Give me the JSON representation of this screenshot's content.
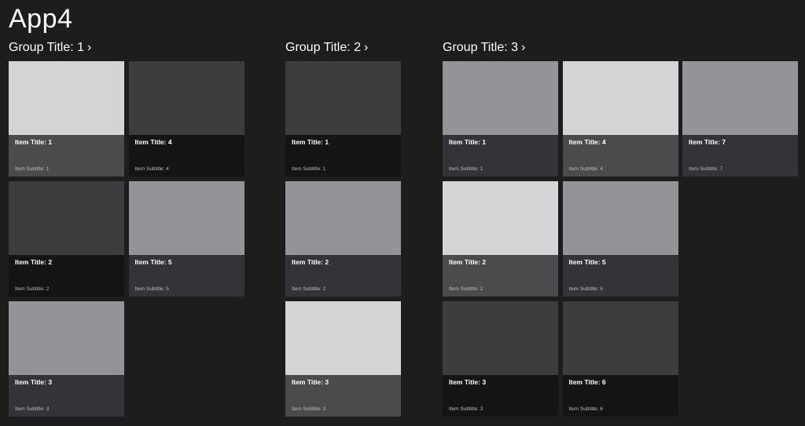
{
  "app": {
    "title": "App4"
  },
  "groups": [
    {
      "title": "Group Title: 1",
      "items": [
        {
          "title": "Item Title: 1",
          "subtitle": "Item Subtitle: 1",
          "shade": "light"
        },
        {
          "title": "Item Title: 2",
          "subtitle": "Item Subtitle: 2",
          "shade": "dark"
        },
        {
          "title": "Item Title: 3",
          "subtitle": "Item Subtitle: 3",
          "shade": "mid"
        },
        {
          "title": "Item Title: 4",
          "subtitle": "Item Subtitle: 4",
          "shade": "dark"
        },
        {
          "title": "Item Title: 5",
          "subtitle": "Item Subtitle: 5",
          "shade": "mid"
        }
      ]
    },
    {
      "title": "Group Title: 2",
      "items": [
        {
          "title": "Item Title: 1",
          "subtitle": "Item Subtitle: 1",
          "shade": "dark"
        },
        {
          "title": "Item Title: 2",
          "subtitle": "Item Subtitle: 2",
          "shade": "mid"
        },
        {
          "title": "Item Title: 3",
          "subtitle": "Item Subtitle: 3",
          "shade": "light"
        }
      ]
    },
    {
      "title": "Group Title: 3",
      "items": [
        {
          "title": "Item Title: 1",
          "subtitle": "Item Subtitle: 1",
          "shade": "mid"
        },
        {
          "title": "Item Title: 2",
          "subtitle": "Item Subtitle: 2",
          "shade": "light"
        },
        {
          "title": "Item Title: 3",
          "subtitle": "Item Subtitle: 3",
          "shade": "dark"
        },
        {
          "title": "Item Title: 4",
          "subtitle": "Item Subtitle: 4",
          "shade": "light"
        },
        {
          "title": "Item Title: 5",
          "subtitle": "Item Subtitle: 5",
          "shade": "mid"
        },
        {
          "title": "Item Title: 6",
          "subtitle": "Item Subtitle: 6",
          "shade": "dark"
        },
        {
          "title": "Item Title: 7",
          "subtitle": "Item Subtitle: 7",
          "shade": "mid"
        }
      ]
    }
  ],
  "colors": {
    "background": "#1d1d1d",
    "light_image": "#d3d4d6",
    "mid_image": "#939497",
    "dark_image": "#3d3d3f"
  }
}
